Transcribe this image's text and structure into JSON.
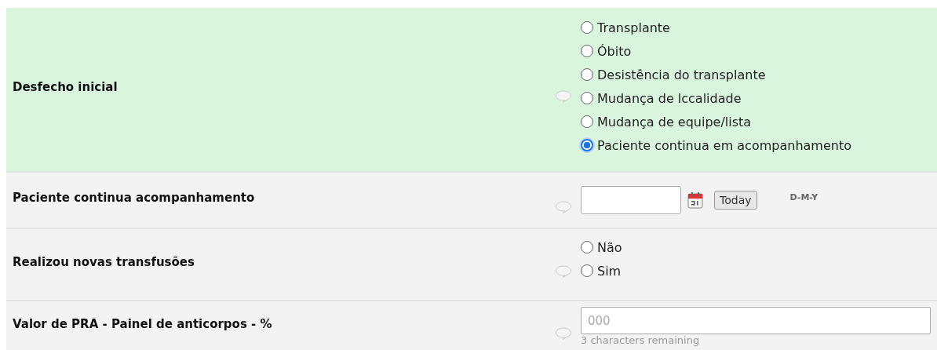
{
  "fields": [
    {
      "kind": "radio",
      "label": "Desfecho inicial",
      "highlighted": true,
      "options": [
        {
          "label": "Transplante",
          "selected": false
        },
        {
          "label": "Óbito",
          "selected": false
        },
        {
          "label": "Desistência do transplante",
          "selected": false
        },
        {
          "label": "Mudança de lccalidade",
          "selected": false
        },
        {
          "label": "Mudança de equipe/lista",
          "selected": false
        },
        {
          "label": "Paciente continua em acompanhamento",
          "selected": true
        }
      ]
    },
    {
      "kind": "date",
      "label": "Paciente continua acompanhamento",
      "highlighted": false,
      "button": "Today",
      "format": "D-M-Y"
    },
    {
      "kind": "radio",
      "label": "Realizou novas transfusões",
      "highlighted": false,
      "options": [
        {
          "label": "Não",
          "selected": false
        },
        {
          "label": "Sim",
          "selected": false
        }
      ]
    },
    {
      "kind": "text",
      "label": "Valor de PRA - Painel de anticorpos - %",
      "highlighted": false,
      "placeholder": "000",
      "hint": "3 characters remaining"
    }
  ]
}
